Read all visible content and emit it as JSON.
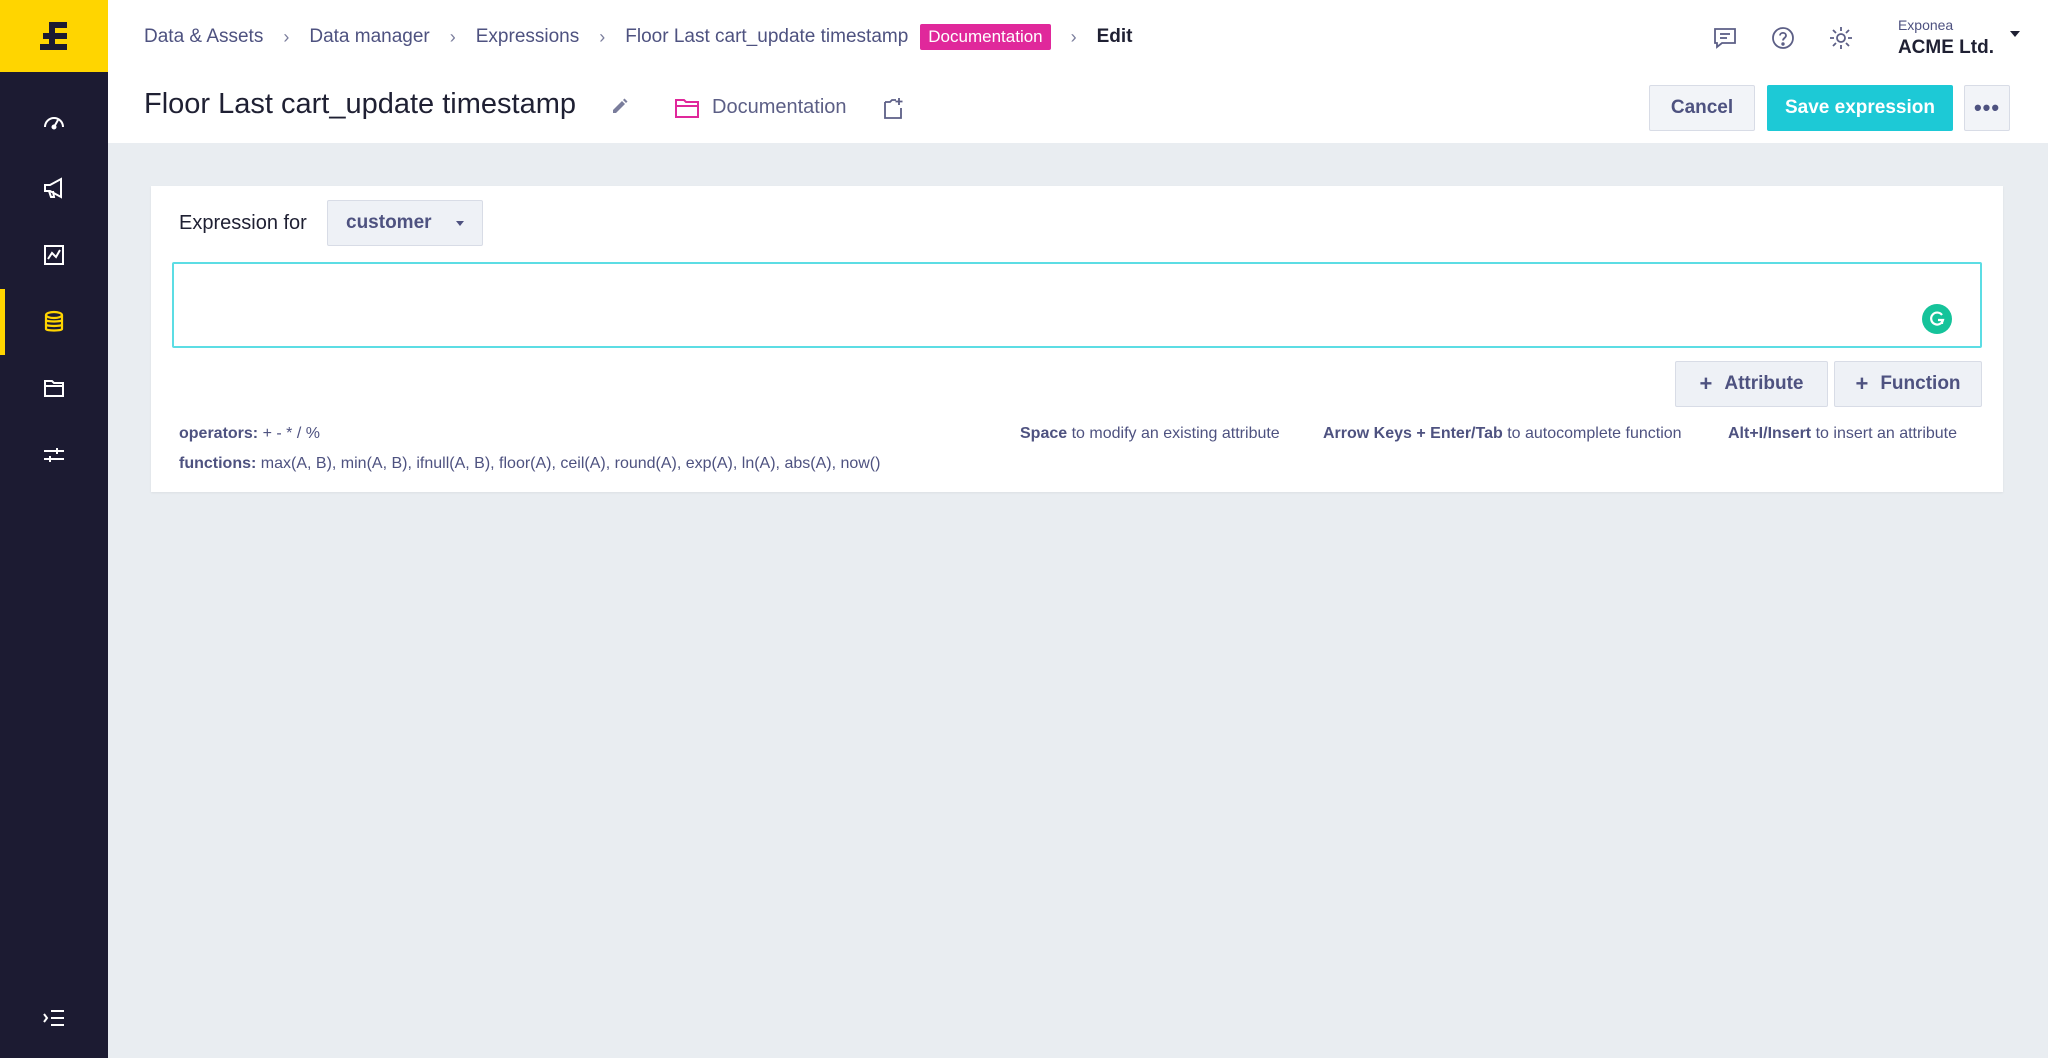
{
  "brand": {
    "accent": "#ffd500",
    "primary": "#1dc9d6",
    "badge": "#e0289b",
    "sidebar_bg": "#1c1b32"
  },
  "sidebar": {
    "items": [
      {
        "icon": "gauge-icon"
      },
      {
        "icon": "megaphone-icon"
      },
      {
        "icon": "chart-icon"
      },
      {
        "icon": "database-icon",
        "active": true
      },
      {
        "icon": "folder-icon"
      },
      {
        "icon": "settings-sliders-icon"
      }
    ],
    "collapse_icon": "expand-sidebar-icon"
  },
  "breadcrumb": {
    "items": [
      "Data & Assets",
      "Data manager",
      "Expressions",
      "Floor Last cart_update timestamp"
    ],
    "badge": "Documentation",
    "current": "Edit"
  },
  "header": {
    "icons": [
      "chat-icon",
      "help-icon",
      "settings-icon"
    ],
    "account_org": "Exponea",
    "account_name": "ACME Ltd."
  },
  "page": {
    "title": "Floor Last cart_update timestamp",
    "folder_label": "Documentation",
    "cancel_label": "Cancel",
    "save_label": "Save expression",
    "more_label": "•••"
  },
  "editor": {
    "expression_for_label": "Expression for",
    "entity_select_value": "customer",
    "expression_value": "",
    "add_attribute_label": "Attribute",
    "add_function_label": "Function",
    "operators_label": "operators:",
    "operators_value": "+ - * / %",
    "functions_label": "functions:",
    "functions_value": "max(A, B), min(A, B), ifnull(A, B), floor(A), ceil(A), round(A), exp(A), ln(A), abs(A), now()",
    "hint_space_key": "Space",
    "hint_space_text": "to modify an existing attribute",
    "hint_arrow_key": "Arrow Keys + Enter/Tab",
    "hint_arrow_text": "to autocomplete function",
    "hint_alt_key": "Alt+I/Insert",
    "hint_alt_text": "to insert an attribute"
  }
}
